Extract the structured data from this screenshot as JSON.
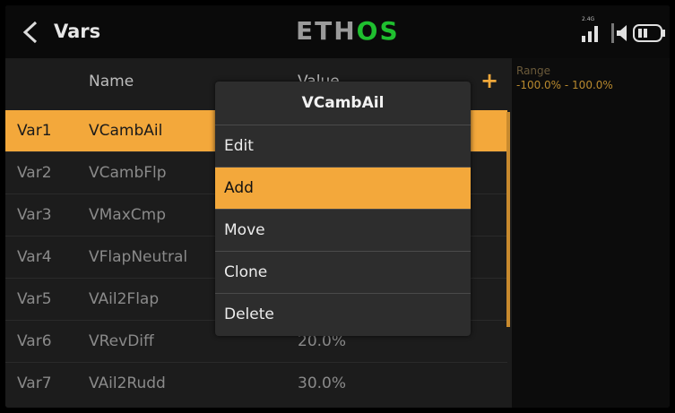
{
  "header": {
    "title": "Vars",
    "logo_part1": "ETH",
    "logo_part2": "OS",
    "rf_label": "2.4G"
  },
  "table": {
    "columns": {
      "name": "Name",
      "value": "Value"
    },
    "add_symbol": "+",
    "rows": [
      {
        "id": "Var1",
        "name": "VCambAil",
        "value": "",
        "selected": true
      },
      {
        "id": "Var2",
        "name": "VCambFlp",
        "value": ""
      },
      {
        "id": "Var3",
        "name": "VMaxCmp",
        "value": ""
      },
      {
        "id": "Var4",
        "name": "VFlapNeutral",
        "value": ""
      },
      {
        "id": "Var5",
        "name": "VAil2Flap",
        "value": ""
      },
      {
        "id": "Var6",
        "name": "VRevDiff",
        "value": "20.0%"
      },
      {
        "id": "Var7",
        "name": "VAil2Rudd",
        "value": "30.0%"
      }
    ]
  },
  "info": {
    "label": "Range",
    "value": "-100.0% - 100.0%"
  },
  "popup": {
    "title": "VCambAil",
    "items": [
      {
        "label": "Edit"
      },
      {
        "label": "Add",
        "selected": true
      },
      {
        "label": "Move"
      },
      {
        "label": "Clone"
      },
      {
        "label": "Delete"
      }
    ]
  },
  "colors": {
    "accent": "#f3a83b",
    "logo_green": "#1fbf2f",
    "background": "#1c1c1c"
  },
  "icons": [
    "back-chevron-icon",
    "plus-icon",
    "signal-bars-icon",
    "speaker-icon",
    "battery-icon"
  ]
}
